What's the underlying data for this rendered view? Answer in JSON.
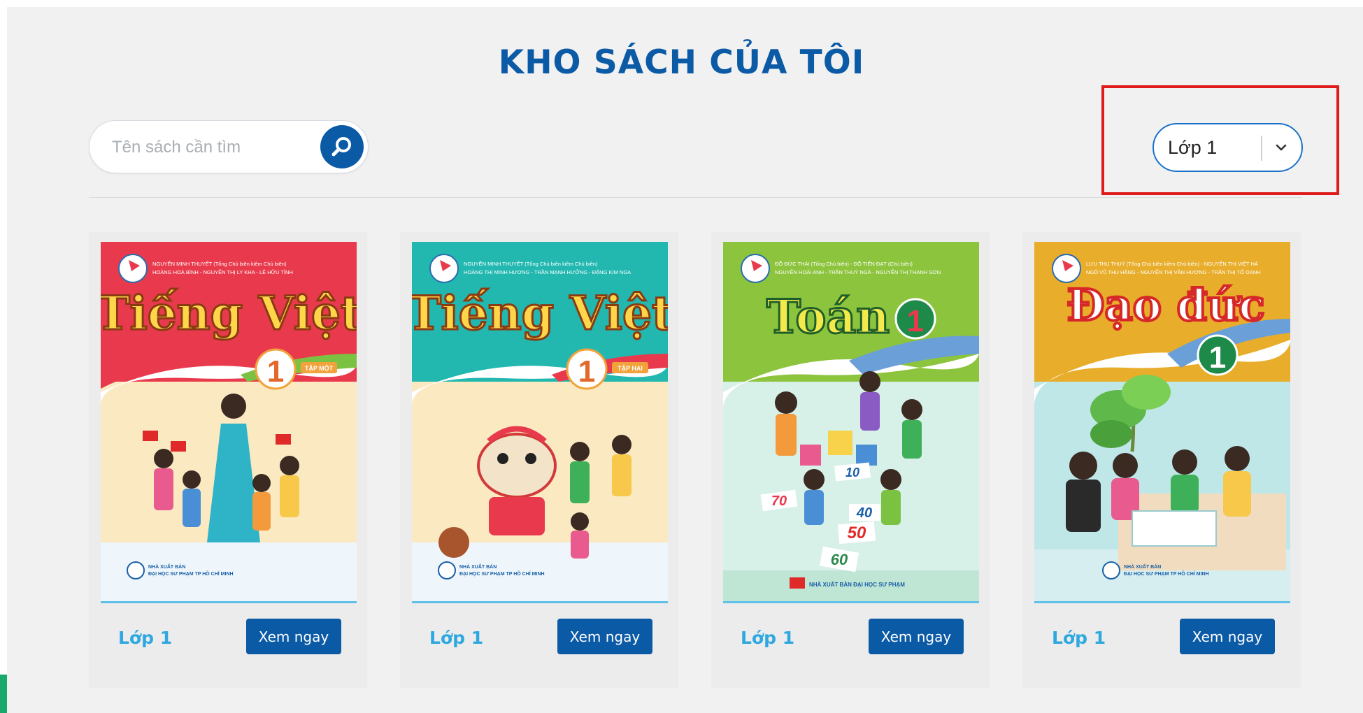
{
  "page": {
    "title": "KHO SÁCH CỦA TÔI"
  },
  "search": {
    "placeholder": "Tên sách cần tìm",
    "icon": "search-icon"
  },
  "filter": {
    "selected": "Lớp 1",
    "icon": "chevron-down-icon"
  },
  "colors": {
    "brand_blue": "#0b5aa6",
    "highlight_red": "#e01b1b",
    "grade_text": "#2fa8e0"
  },
  "books": [
    {
      "cover_title": "Tiếng Việt",
      "cover_number": "1",
      "cover_badge": "TẬP MỘT",
      "authors_line1": "NGUYỄN MINH THUYẾT (Tổng Chủ biên kiêm Chủ biên)",
      "authors_line2": "HOÀNG HOÀ BÌNH - NGUYỄN THỊ LY KHA - LÊ HỮU TỈNH",
      "publisher_line1": "NHÀ XUẤT BẢN",
      "publisher_line2": "ĐẠI HỌC SƯ PHẠM TP HỒ CHÍ MINH",
      "grade": "Lớp 1",
      "button": "Xem ngay"
    },
    {
      "cover_title": "Tiếng Việt",
      "cover_number": "1",
      "cover_badge": "TẬP HAI",
      "authors_line1": "NGUYỄN MINH THUYẾT (Tổng Chủ biên kiêm Chủ biên)",
      "authors_line2": "HOÀNG THỊ MINH HƯƠNG - TRẦN MẠNH HƯỞNG - ĐẶNG KIM NGA",
      "publisher_line1": "NHÀ XUẤT BẢN",
      "publisher_line2": "ĐẠI HỌC SƯ PHẠM TP HỒ CHÍ MINH",
      "grade": "Lớp 1",
      "button": "Xem ngay"
    },
    {
      "cover_title": "Toán",
      "cover_number": "1",
      "cover_badge": "",
      "authors_line1": "ĐỖ ĐỨC THÁI (Tổng Chủ biên) - ĐỖ TIẾN ĐẠT (Chủ biên)",
      "authors_line2": "NGUYỄN HOÀI ANH - TRẦN THUÝ NGÀ - NGUYỄN THỊ THANH SƠN",
      "publisher_line1": "NHÀ XUẤT BẢN ĐẠI HỌC SƯ PHẠM",
      "publisher_line2": "",
      "grade": "Lớp 1",
      "button": "Xem ngay"
    },
    {
      "cover_title": "Đạo đức",
      "cover_number": "1",
      "cover_badge": "",
      "authors_line1": "LƯU THU THUỶ (Tổng Chủ biên kiêm Chủ biên) - NGUYỄN THỊ VIỆT HÀ",
      "authors_line2": "NGÔ VŨ THU HẰNG - NGUYỄN THỊ VÂN HƯƠNG - TRẦN THỊ TỐ OANH",
      "publisher_line1": "NHÀ XUẤT BẢN",
      "publisher_line2": "ĐẠI HỌC SƯ PHẠM TP HỒ CHÍ MINH",
      "grade": "Lớp 1",
      "button": "Xem ngay"
    }
  ]
}
